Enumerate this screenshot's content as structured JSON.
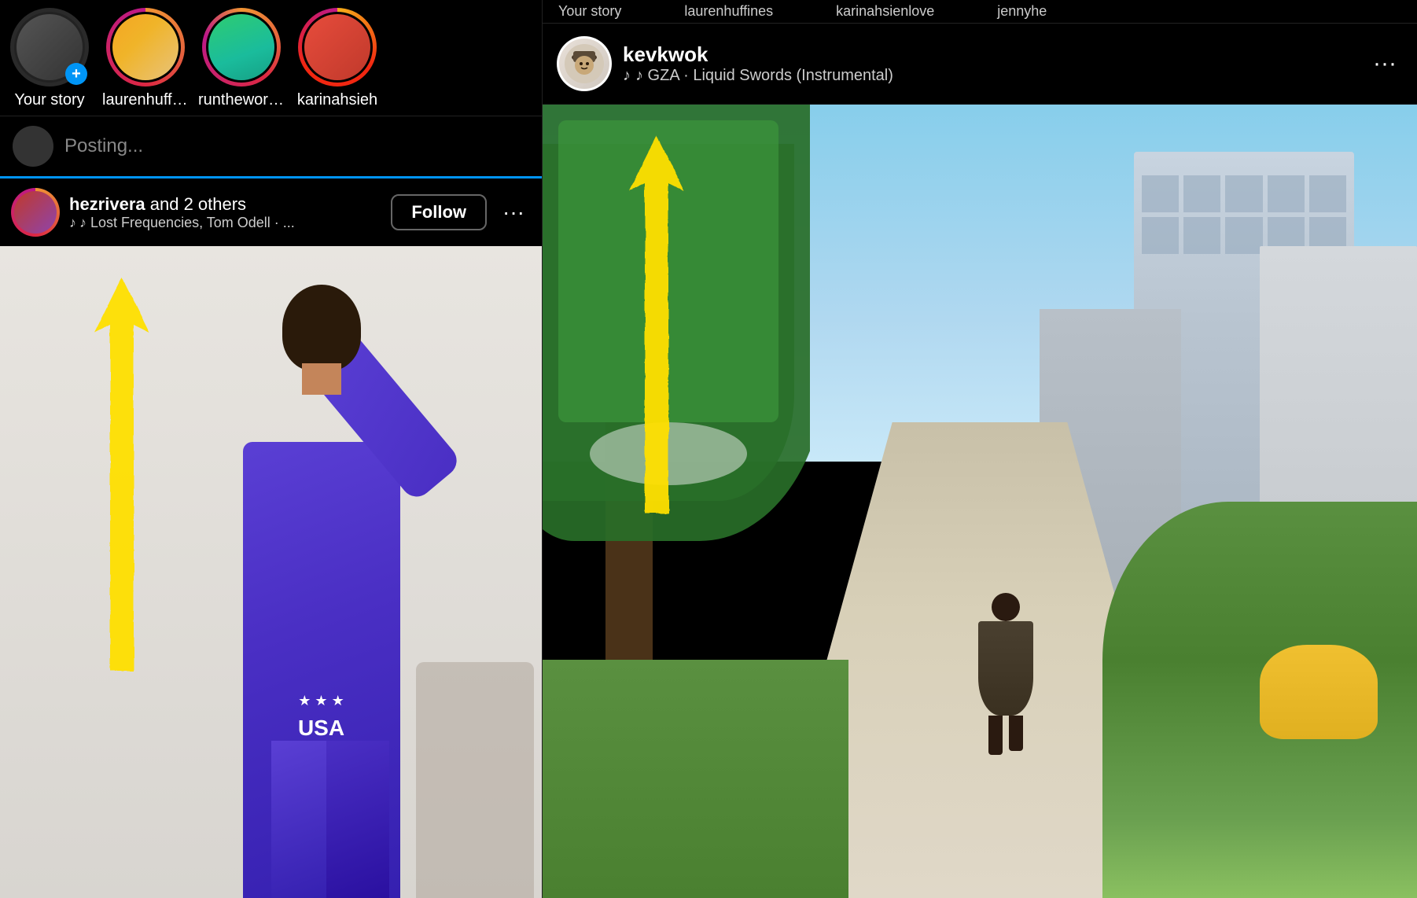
{
  "left": {
    "stories": [
      {
        "id": "your-story",
        "label": "Your story",
        "ring": "none",
        "avatarClass": "your-story-avatar",
        "hasAdd": true
      },
      {
        "id": "laurenhuffines",
        "label": "laurenhuffines",
        "ring": "gradient",
        "avatarClass": "avatar-lauren",
        "hasAdd": false
      },
      {
        "id": "runtheworldwide",
        "label": "runtheworldwide",
        "ring": "gradient",
        "avatarClass": "avatar-run",
        "hasAdd": false
      },
      {
        "id": "karinahsieh",
        "label": "karinahsieh",
        "ring": "gradient",
        "avatarClass": "avatar-karina",
        "hasAdd": false
      }
    ],
    "posting": {
      "text": "Posting..."
    },
    "feed": {
      "username": "hezrivera",
      "and_others": "and 2 others",
      "music": "♪ Lost Frequencies, Tom Odell · ...",
      "follow_label": "Follow",
      "more_label": "···"
    }
  },
  "right": {
    "top_story_labels": [
      "Your story",
      "laurenhuffines",
      "karinahsienlove",
      "jennyhe"
    ],
    "feed": {
      "username": "kevkwok",
      "music": "♪ GZA · Liquid Swords (Instrumental)",
      "more_label": "···"
    }
  },
  "icons": {
    "music_note": "♪",
    "add_plus": "+",
    "more_dots": "···"
  }
}
